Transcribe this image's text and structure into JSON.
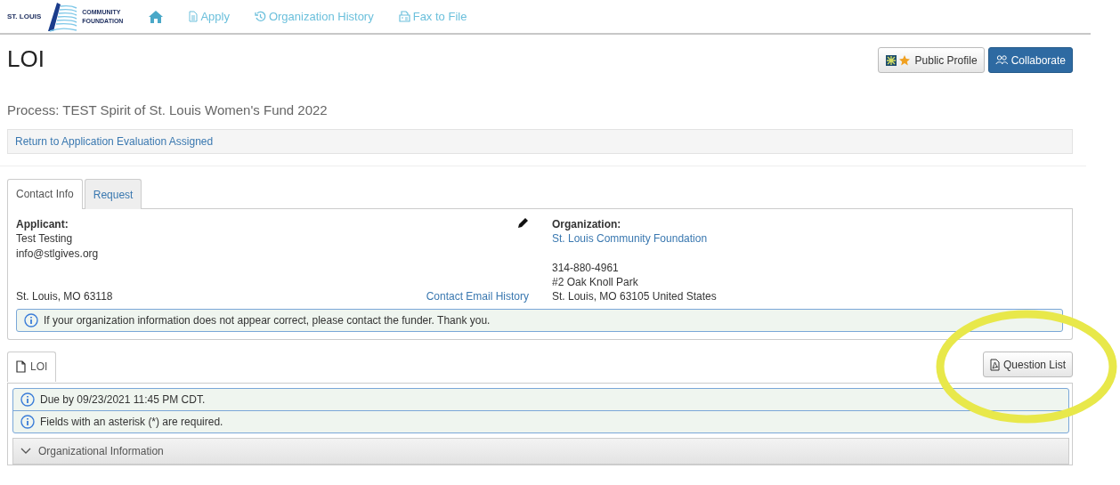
{
  "logo": {
    "name": "ST. LOUIS",
    "tagline_1": "COMMUNITY",
    "tagline_2": "FOUNDATION"
  },
  "nav": [
    {
      "kind": "home"
    },
    {
      "kind": "doc",
      "label": "Apply"
    },
    {
      "kind": "history",
      "label": "Organization History"
    },
    {
      "kind": "fax",
      "label": "Fax to File"
    }
  ],
  "page": {
    "title": "LOI",
    "buttons": [
      {
        "kind": "profile",
        "label": "Public Profile"
      },
      {
        "kind": "collaborate",
        "label": "Collaborate"
      }
    ],
    "process": "Process: TEST Spirit of St. Louis Women's Fund 2022",
    "return_link": "Return to Application Evaluation Assigned"
  },
  "contact_tabs": [
    {
      "label": "Contact Info",
      "selected": true
    },
    {
      "label": "Request",
      "selected": false
    }
  ],
  "applicant": {
    "heading": "Applicant:",
    "name": "Test Testing",
    "email": "info@stlgives.org",
    "city": "St. Louis, MO 63118",
    "history_link": "Contact Email History"
  },
  "organization": {
    "heading": "Organization:",
    "name": "St. Louis Community Foundation",
    "phone": "314-880-4961",
    "address": "#2 Oak Knoll Park",
    "city": "St. Louis, MO 63105 United States"
  },
  "contact_notice": "If your organization information does not appear correct, please contact the funder. Thank you.",
  "form_tabs": [
    {
      "label": "LOI",
      "selected": true
    }
  ],
  "question_list_button": "Question List",
  "form_notices": [
    "Due by 09/23/2021 11:45 PM CDT.",
    "Fields with an asterisk (*) are required."
  ],
  "sections": [
    {
      "title": "Organizational Information",
      "expanded": true
    }
  ]
}
